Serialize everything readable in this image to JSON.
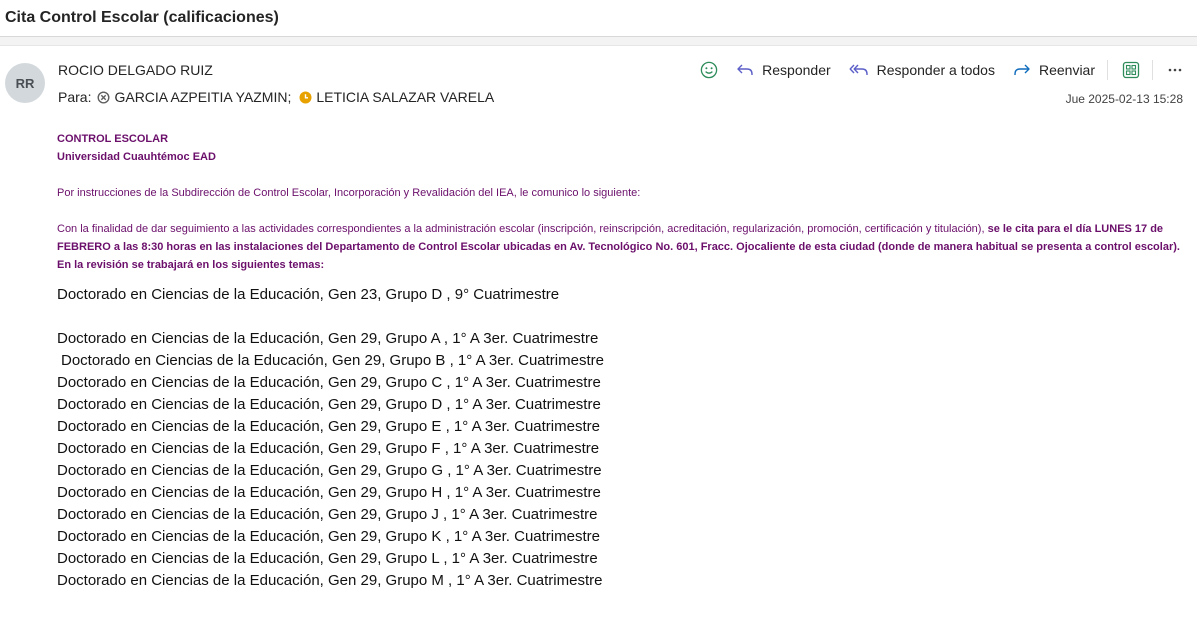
{
  "subject": "Cita Control Escolar (calificaciones)",
  "sender": {
    "initials": "RR",
    "name": "ROCIO DELGADO RUIZ"
  },
  "to": {
    "label": "Para:",
    "recipients": [
      {
        "name": "GARCIA AZPEITIA YAZMIN;",
        "status": "busy-icon"
      },
      {
        "name": "LETICIA SALAZAR VARELA",
        "status": "away-icon"
      }
    ]
  },
  "actions": {
    "reply": "Responder",
    "reply_all": "Responder a todos",
    "forward": "Reenviar"
  },
  "timestamp": "Jue 2025-02-13 15:28",
  "colors": {
    "accent": "#6b0f6b",
    "busy": "#5f5f5f",
    "away": "#e8a200",
    "emoji": "#2d8c5a"
  },
  "body": {
    "sig_line1": "CONTROL ESCOLAR",
    "sig_line2": "Universidad Cuauhtémoc EAD",
    "intro": "Por instrucciones de la Subdirección de Control Escolar, Incorporación y Revalidación del IEA, le comunico lo siguiente:",
    "para_normal": "Con la finalidad de dar seguimiento a las actividades correspondientes a la administración escolar (inscripción, reinscripción, acreditación, regularización, promoción, certificación y titulación), ",
    "para_bold": "se le cita para el día LUNES 17 de FEBRERO a las 8:30 horas en las instalaciones del Departamento de Control Escolar ubicadas en Av. Tecnológico No. 601, Fracc. Ojocaliente de esta ciudad (donde de manera habitual se presenta a control escolar).  En la revisión se trabajará en los siguientes temas:",
    "program_first": "Doctorado en Ciencias de la Educación, Gen 23, Grupo D  , 9° Cuatrimestre",
    "programs": [
      "Doctorado en Ciencias de la Educación, Gen 29, Grupo A  , 1° A 3er. Cuatrimestre",
      "Doctorado en Ciencias de la Educación, Gen 29, Grupo B  , 1° A 3er. Cuatrimestre",
      "Doctorado en Ciencias de la Educación, Gen 29, Grupo C  , 1° A 3er. Cuatrimestre",
      "Doctorado en Ciencias de la Educación, Gen 29, Grupo D  , 1° A 3er. Cuatrimestre",
      "Doctorado en Ciencias de la Educación, Gen 29, Grupo E  , 1° A 3er. Cuatrimestre",
      "Doctorado en Ciencias de la Educación, Gen 29, Grupo F  , 1° A 3er. Cuatrimestre",
      "Doctorado en Ciencias de la Educación, Gen 29, Grupo G  , 1° A 3er. Cuatrimestre",
      "Doctorado en Ciencias de la Educación, Gen 29, Grupo H  , 1° A 3er. Cuatrimestre",
      "Doctorado en Ciencias de la Educación, Gen 29, Grupo J  , 1° A 3er. Cuatrimestre",
      "Doctorado en Ciencias de la Educación, Gen 29, Grupo K  , 1° A 3er. Cuatrimestre",
      "Doctorado en Ciencias de la Educación, Gen 29, Grupo L  , 1° A 3er. Cuatrimestre",
      "Doctorado en Ciencias de la Educación, Gen 29, Grupo M  , 1° A 3er. Cuatrimestre"
    ]
  }
}
